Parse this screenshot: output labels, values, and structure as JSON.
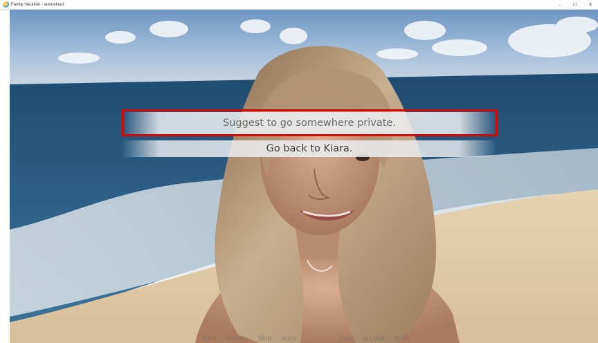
{
  "window": {
    "title": "Family Vacation - autoreload",
    "controls": {
      "minimize": "–",
      "maximize": "☐",
      "close": "✕"
    },
    "app_icon": "renpy-app-icon"
  },
  "menu": {
    "choices": [
      {
        "label": "Suggest to go somewhere private.",
        "highlighted": true
      },
      {
        "label": "Go back to Kiara.",
        "highlighted": false
      }
    ],
    "highlight_color": "#d10a0a"
  },
  "quick_menu": {
    "items": [
      "Back",
      "History",
      "Skip",
      "Auto",
      "Save",
      "Q.Load",
      "Prefs"
    ]
  },
  "colors": {
    "sky": "#8fb3d6",
    "sea": "#2f5f83",
    "sand": "#e0c9a6",
    "hair": "#a78868",
    "skin": "#c79b80"
  }
}
